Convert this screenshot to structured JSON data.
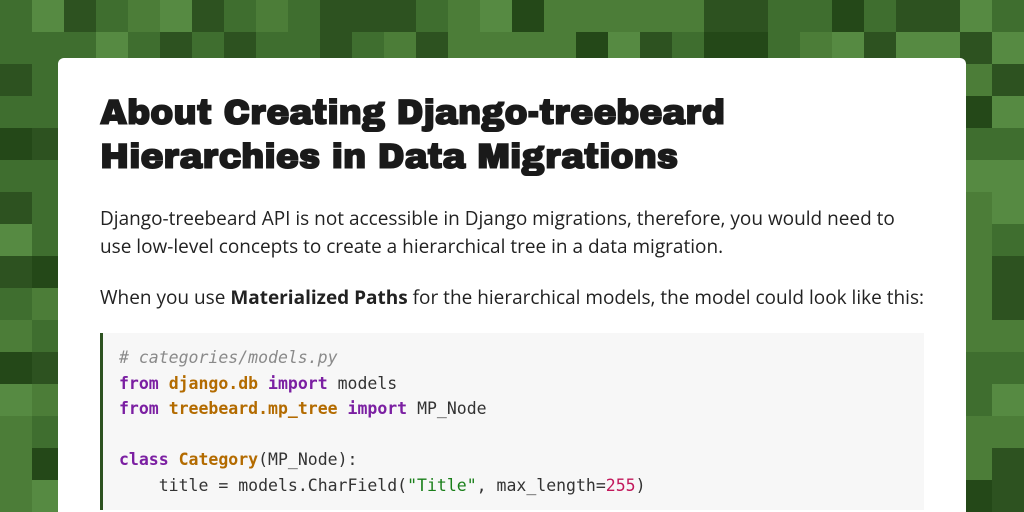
{
  "article": {
    "title": "About Creating Django-treebeard Hierarchies in Data Migrations",
    "p1": "Django-treebeard API is not accessible in Django migrations, therefore, you would need to use low-level concepts to create a hierarchical tree in a data migration.",
    "p2_pre": "When you use ",
    "p2_strong": "Materialized Paths",
    "p2_post": " for the hierarchical models, the model could look like this:",
    "code": {
      "l1_comment": "# categories/models.py",
      "l2_from": "from",
      "l2_mod": "django.db",
      "l2_import": "import",
      "l2_id": "models",
      "l3_from": "from",
      "l3_mod": "treebeard.mp_tree",
      "l3_import": "import",
      "l3_id": "MP_Node",
      "l5_class": "class",
      "l5_name": "Category",
      "l5_paren_open": "(",
      "l5_base": "MP_Node",
      "l5_paren_close": "):",
      "l6_indent": "    ",
      "l6_lhs": "title = models.CharField(",
      "l6_str": "\"Title\"",
      "l6_comma": ", max_length=",
      "l6_num": "255",
      "l6_close": ")"
    }
  }
}
